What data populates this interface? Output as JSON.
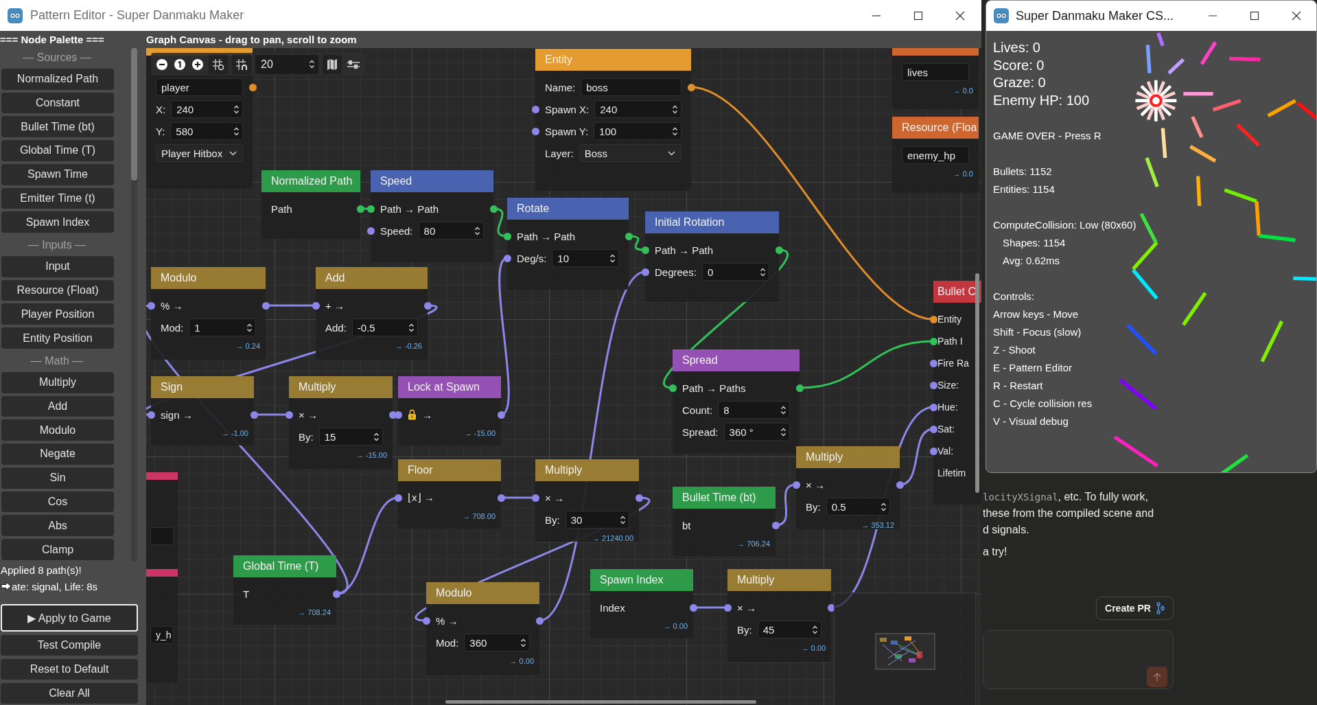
{
  "editor_window": {
    "title": "Pattern Editor - Super Danmaku Maker"
  },
  "palette": {
    "header": "=== Node Palette ===",
    "sections": [
      {
        "title": "— Sources —",
        "items": [
          "Normalized Path",
          "Constant",
          "Bullet Time (bt)",
          "Global Time (T)",
          "Spawn Time",
          "Emitter Time (t)",
          "Spawn Index"
        ]
      },
      {
        "title": "— Inputs —",
        "items": [
          "Input",
          "Resource (Float)",
          "Player Position",
          "Entity Position"
        ]
      },
      {
        "title": "— Math —",
        "items": [
          "Multiply",
          "Add",
          "Modulo",
          "Negate",
          "Sin",
          "Cos",
          "Abs",
          "Clamp"
        ]
      }
    ],
    "status": [
      "Applied 8 path(s)!",
      "ate: signal, Life: 8s"
    ],
    "actions": [
      {
        "label": "▶ Apply to Game",
        "focused": true
      },
      {
        "label": "Test Compile",
        "focused": false
      },
      {
        "label": "Reset to Default",
        "focused": false
      },
      {
        "label": "Clear All",
        "focused": false
      }
    ]
  },
  "canvas": {
    "header": "Graph Canvas - drag to pan, scroll to zoom",
    "snap_distance": "20",
    "nodes": [
      {
        "color": "#e49b30",
        "rows": [
          {
            "kind": "text-field",
            "value": "player",
            "out": {
              "color": "#e08e2a"
            }
          },
          {
            "kind": "field",
            "label": "X:",
            "value": "240"
          },
          {
            "kind": "field",
            "label": "Y:",
            "value": "580"
          },
          {
            "kind": "dropdown",
            "value": "Player Hitbox"
          }
        ]
      },
      {
        "title": "Entity",
        "color": "#e49b30",
        "rows": [
          {
            "kind": "text-field",
            "label": "Name:",
            "value": "boss",
            "out": {
              "color": "#e08e2a"
            }
          },
          {
            "kind": "field",
            "label": "Spawn X:",
            "value": "240",
            "in": {
              "color": "#8c87e8"
            }
          },
          {
            "kind": "field",
            "label": "Spawn Y:",
            "value": "100",
            "in": {
              "color": "#8c87e8"
            }
          },
          {
            "kind": "dropdown",
            "label": "Layer:",
            "value": "Boss"
          }
        ]
      },
      {
        "color": "#d0662f",
        "rows": [
          {
            "kind": "text-field",
            "value": "lives"
          },
          {
            "kind": "output",
            "value": "→ 0.0"
          }
        ]
      },
      {
        "title": "Resource (Floa",
        "color": "#d0662f",
        "rows": [
          {
            "kind": "text-field",
            "value": "enemy_hp"
          },
          {
            "kind": "output",
            "value": "→ 0.0"
          }
        ]
      },
      {
        "title": "Normalized Path",
        "color": "#2e9b4a",
        "rows": [
          {
            "kind": "port",
            "label": "Path",
            "out": {
              "color": "#33c05a"
            }
          }
        ]
      },
      {
        "title": "Speed",
        "color": "#4a63b0",
        "rows": [
          {
            "kind": "port",
            "label": "Path → Path",
            "in": {
              "color": "#33c05a"
            },
            "out": {
              "color": "#33c05a"
            }
          },
          {
            "kind": "field",
            "label": "Speed:",
            "value": "80",
            "in": {
              "color": "#8c87e8"
            }
          }
        ]
      },
      {
        "title": "Rotate",
        "color": "#4a63b0",
        "rows": [
          {
            "kind": "port",
            "label": "Path → Path",
            "in": {
              "color": "#33c05a"
            },
            "out": {
              "color": "#33c05a"
            }
          },
          {
            "kind": "field",
            "label": "Deg/s:",
            "value": "10",
            "in": {
              "color": "#8c87e8"
            }
          }
        ]
      },
      {
        "title": "Initial Rotation",
        "color": "#4a63b0",
        "rows": [
          {
            "kind": "port",
            "label": "Path → Path",
            "in": {
              "color": "#33c05a"
            },
            "out": {
              "color": "#33c05a"
            }
          },
          {
            "kind": "field",
            "label": "Degrees:",
            "value": "0",
            "in": {
              "color": "#8c87e8"
            }
          }
        ]
      },
      {
        "title": "Modulo",
        "color": "#987c34",
        "rows": [
          {
            "kind": "port",
            "label": "% →",
            "in": {
              "color": "#8c87e8"
            },
            "out": {
              "color": "#8c87e8"
            }
          },
          {
            "kind": "field",
            "label": "Mod:",
            "value": "1"
          },
          {
            "kind": "output",
            "value": "→ 0.24"
          }
        ]
      },
      {
        "title": "Add",
        "color": "#987c34",
        "rows": [
          {
            "kind": "port",
            "label": "+ →",
            "in": {
              "color": "#8c87e8"
            },
            "out": {
              "color": "#8c87e8"
            }
          },
          {
            "kind": "field",
            "label": "Add:",
            "value": "-0.5"
          },
          {
            "kind": "output",
            "value": "→ -0.26"
          }
        ]
      },
      {
        "title": "Sign",
        "color": "#987c34",
        "rows": [
          {
            "kind": "port",
            "label": "sign →",
            "in": {
              "color": "#8c87e8"
            },
            "out": {
              "color": "#8c87e8"
            }
          },
          {
            "kind": "output",
            "value": "→ -1.00"
          }
        ]
      },
      {
        "title": "Multiply",
        "color": "#987c34",
        "rows": [
          {
            "kind": "port",
            "label": "× →",
            "in": {
              "color": "#8c87e8"
            },
            "out": {
              "color": "#8c87e8"
            }
          },
          {
            "kind": "field",
            "label": "By:",
            "value": "15"
          },
          {
            "kind": "output",
            "value": "→ -15.00"
          }
        ]
      },
      {
        "title": "Lock at Spawn",
        "color": "#9550b4",
        "rows": [
          {
            "kind": "lock-port",
            "label": "→",
            "in": {
              "color": "#8c87e8"
            },
            "out": {
              "color": "#8c87e8"
            }
          },
          {
            "kind": "output",
            "value": "→ -15.00"
          }
        ]
      },
      {
        "title": "Spread",
        "color": "#9550b4",
        "rows": [
          {
            "kind": "port",
            "label": "Path → Paths",
            "in": {
              "color": "#33c05a"
            },
            "out": {
              "color": "#33c05a"
            }
          },
          {
            "kind": "field",
            "label": "Count:",
            "value": "8"
          },
          {
            "kind": "field",
            "label": "Spread:",
            "value": "360 °"
          }
        ]
      },
      {
        "title": "Bullet C",
        "color": "#c2363d",
        "rows": [
          {
            "kind": "port",
            "label": "Entity",
            "in": {
              "color": "#e08e2a"
            }
          },
          {
            "kind": "port",
            "label": "Path I",
            "in": {
              "color": "#33c05a"
            }
          },
          {
            "kind": "port",
            "label": "Fire Ra",
            "in": {
              "color": "#8c87e8"
            }
          },
          {
            "kind": "port",
            "label": "Size:",
            "in": {
              "color": "#8c87e8"
            }
          },
          {
            "kind": "port",
            "label": "Hue:",
            "in": {
              "color": "#8c87e8"
            }
          },
          {
            "kind": "port",
            "label": "Sat:",
            "in": {
              "color": "#8c87e8"
            }
          },
          {
            "kind": "port",
            "label": "Val:",
            "in": {
              "color": "#8c87e8"
            }
          },
          {
            "kind": "port",
            "label": "Lifetim"
          }
        ]
      },
      {
        "title": "Floor",
        "color": "#987c34",
        "rows": [
          {
            "kind": "port",
            "label": "⌊x⌋ →",
            "in": {
              "color": "#8c87e8"
            },
            "out": {
              "color": "#8c87e8"
            }
          },
          {
            "kind": "output",
            "value": "→ 708.00"
          }
        ]
      },
      {
        "title": "Multiply",
        "color": "#987c34",
        "rows": [
          {
            "kind": "port",
            "label": "× →",
            "in": {
              "color": "#8c87e8"
            },
            "out": {
              "color": "#8c87e8"
            }
          },
          {
            "kind": "field",
            "label": "By:",
            "value": "30"
          },
          {
            "kind": "output",
            "value": "→ 21240.00"
          }
        ]
      },
      {
        "title": "Bullet Time (bt)",
        "color": "#2e9b4a",
        "rows": [
          {
            "kind": "port",
            "label": "bt",
            "out": {
              "color": "#8c87e8"
            }
          },
          {
            "kind": "output",
            "value": "→ 706.24"
          }
        ]
      },
      {
        "title": "Multiply",
        "color": "#987c34",
        "rows": [
          {
            "kind": "port",
            "label": "× →",
            "in": {
              "color": "#8c87e8"
            },
            "out": {
              "color": "#8c87e8"
            }
          },
          {
            "kind": "field",
            "label": "By:",
            "value": "0.5"
          },
          {
            "kind": "output",
            "value": "→ 353.12"
          }
        ]
      },
      {
        "title": "Global Time (T)",
        "color": "#2e9b4a",
        "rows": [
          {
            "kind": "port",
            "label": "T",
            "out": {
              "color": "#8c87e8"
            }
          },
          {
            "kind": "output",
            "value": "→ 708.24"
          }
        ]
      },
      {
        "title": "Modulo",
        "color": "#987c34",
        "rows": [
          {
            "kind": "port",
            "label": "% →",
            "in": {
              "color": "#8c87e8"
            },
            "out": {
              "color": "#8c87e8"
            }
          },
          {
            "kind": "field",
            "label": "Mod:",
            "value": "360"
          },
          {
            "kind": "output",
            "value": "→ 0.00"
          }
        ]
      },
      {
        "title": "Spawn Index",
        "color": "#2e9b4a",
        "rows": [
          {
            "kind": "port",
            "label": "Index",
            "out": {
              "color": "#8c87e8"
            }
          },
          {
            "kind": "output",
            "value": "→ 0.00"
          }
        ]
      },
      {
        "title": "Multiply",
        "color": "#987c34",
        "rows": [
          {
            "kind": "port",
            "label": "× →",
            "in": {
              "color": "#8c87e8"
            },
            "out": {
              "color": "#8c87e8"
            }
          },
          {
            "kind": "field",
            "label": "By:",
            "value": "45"
          },
          {
            "kind": "output",
            "value": "→ 0.00"
          }
        ]
      },
      {
        "color": "#cc3566",
        "rows": [
          {
            "kind": "text-field"
          }
        ]
      },
      {
        "color": "#cc3566",
        "rows": [
          {
            "kind": "text-field",
            "value": "y_h"
          }
        ]
      }
    ]
  },
  "game_window": {
    "title": "Super Danmaku Maker CS...",
    "stats": [
      "Lives: 0",
      "Score: 0",
      "Graze: 0",
      "Enemy HP: 100"
    ],
    "groups": [
      [
        {
          "text": "GAME OVER - Press R"
        }
      ],
      [
        {
          "text": "Bullets: 1152"
        },
        {
          "text": "Entities: 1154"
        }
      ],
      [
        {
          "text": "ComputeCollision: Low (80x60)",
          "children": [
            "Shapes: 1154",
            "Avg: 0.62ms"
          ]
        }
      ],
      [
        {
          "text": "Controls:"
        },
        {
          "text": "Arrow keys - Move"
        },
        {
          "text": "Shift - Focus (slow)"
        },
        {
          "text": "Z - Shoot"
        },
        {
          "text": "E - Pattern Editor"
        },
        {
          "text": "R - Restart"
        },
        {
          "text": "C - Cycle collision res"
        },
        {
          "text": "V - Visual debug"
        }
      ]
    ]
  },
  "chat": {
    "lines": [
      {
        "code": "locityXSignal",
        "text": ", etc. To fully work,"
      },
      {
        "text": "these from the compiled scene and"
      },
      {
        "text": "d signals."
      },
      {
        "text": "a try!"
      }
    ],
    "create_pr": "Create PR"
  }
}
